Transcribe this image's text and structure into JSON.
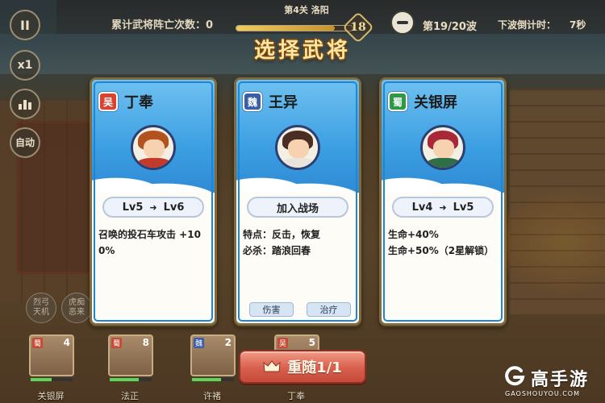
{
  "hud": {
    "stage": "第4关 洛阳",
    "death_count": "累计武将阵亡次数：0",
    "progress_fraction": 0.85,
    "progress_marker": "18",
    "wave": "第19/20波",
    "countdown_label": "下波倒计时：",
    "countdown_value": "7秒"
  },
  "side_buttons": {
    "pause": "II",
    "speed": "x1",
    "auto": "自动"
  },
  "modal": {
    "title": "选择武将"
  },
  "cards": [
    {
      "faction": "吴",
      "faction_color": "#d9432f",
      "name": "丁奉",
      "pill_from": "Lv5",
      "pill_to": "Lv6",
      "desc": [
        "召唤的投石车攻击 +10",
        "0%"
      ],
      "hair_color": "#b2521f",
      "body_color": "#c33a2a"
    },
    {
      "faction": "魏",
      "faction_color": "#3a5fa8",
      "name": "王异",
      "pill_text": "加入战场",
      "desc": [
        "特点：反击，恢复",
        "必杀：踏浪回春"
      ],
      "tags": [
        "伤害",
        "治疗"
      ],
      "hair_color": "#4a2e24",
      "body_color": "#e8e4dc"
    },
    {
      "faction": "蜀",
      "faction_color": "#2f9a45",
      "name": "关银屏",
      "pill_from": "Lv4",
      "pill_to": "Lv5",
      "desc": [
        "生命+40%",
        "生命+50%（2星解锁）"
      ],
      "hair_color": "#a8283a",
      "body_color": "#2f6e47"
    }
  ],
  "bench": [
    "烈弓天机",
    "虎痴恶来"
  ],
  "tiles": [
    {
      "faction": "蜀",
      "level": "4",
      "name": "关银屏",
      "hp": 0.5
    },
    {
      "faction": "蜀",
      "level": "8",
      "name": "法正",
      "hp": 0.7
    },
    {
      "faction": "魏",
      "level": "2",
      "name": "许褚",
      "hp": 0.7
    },
    {
      "faction": "吴",
      "level": "5",
      "name": "丁奉",
      "hp": 0.6
    }
  ],
  "follow_button": {
    "label": "重随1/1"
  },
  "watermark": {
    "name": "高手游",
    "url": "GAOSHOUYOU.COM"
  }
}
